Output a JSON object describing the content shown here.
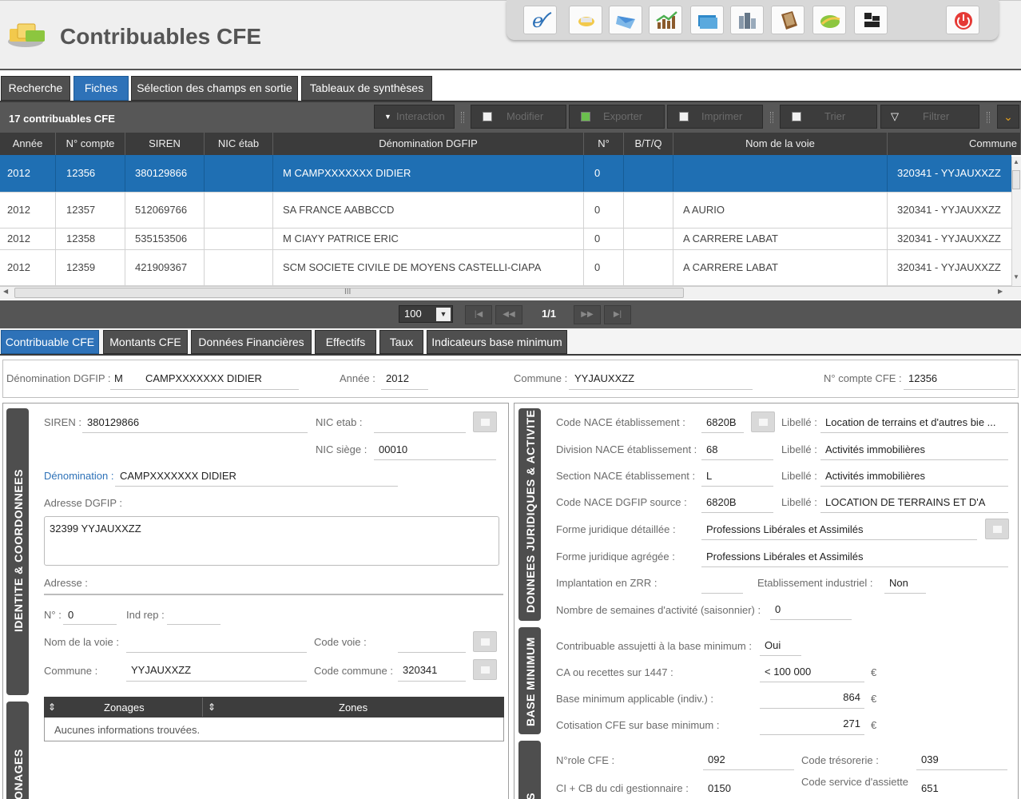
{
  "app": {
    "title": "Contribuables CFE"
  },
  "toolbar": {
    "icons": [
      "e-icon",
      "hand-icon",
      "envelope-icon",
      "growth-chart-icon",
      "card-icon",
      "buildings-icon",
      "document-icon",
      "leaf-icon",
      "blocks-icon",
      "power-icon"
    ]
  },
  "main_tabs": [
    "Recherche",
    "Fiches",
    "Sélection des champs en sortie",
    "Tableaux de synthèses"
  ],
  "grid": {
    "count_label": "17 contribuables CFE",
    "actions": {
      "interaction": "Interaction",
      "modifier": "Modifier",
      "exporter": "Exporter",
      "imprimer": "Imprimer",
      "trier": "Trier",
      "filtrer": "Filtrer"
    },
    "columns": [
      "Année",
      "N° compte",
      "SIREN",
      "NIC étab",
      "Dénomination DGFIP",
      "N°",
      "B/T/Q",
      "Nom de la voie",
      "Commune"
    ],
    "rows": [
      [
        "2012",
        "12356",
        "380129866",
        "",
        "M CAMPXXXXXXX DIDIER",
        "0",
        "",
        "",
        "320341 - YYJAUXXZZ"
      ],
      [
        "2012",
        "12357",
        "512069766",
        "",
        "SA FRANCE AABBCCD",
        "0",
        "",
        "A AURIO",
        "320341 - YYJAUXXZZ"
      ],
      [
        "2012",
        "12358",
        "535153506",
        "",
        "M CIAYY PATRICE ERIC",
        "0",
        "",
        "A CARRERE LABAT",
        "320341 - YYJAUXXZZ"
      ],
      [
        "2012",
        "12359",
        "421909367",
        "",
        "SCM SOCIETE CIVILE DE MOYENS CASTELLI-CIAPA",
        "0",
        "",
        "A CARRERE LABAT",
        "320341 - YYJAUXXZZ"
      ]
    ],
    "hscroll_grip": "III"
  },
  "pager": {
    "page_size": "100",
    "page_info": "1/1",
    "first": "|◀",
    "prev": "◀◀",
    "next": "▶▶",
    "last": "▶|"
  },
  "detail_tabs": [
    "Contribuable CFE",
    "Montants CFE",
    "Données Financières",
    "Effectifs",
    "Taux",
    "Indicateurs base minimum"
  ],
  "summary": {
    "denom_label": "Dénomination DGFIP :",
    "denom_civ": "M",
    "denom_name": "CAMPXXXXXXX DIDIER",
    "annee_label": "Année :",
    "annee": "2012",
    "commune_label": "Commune :",
    "commune": "YYJAUXXZZ",
    "compte_label": "N° compte CFE :",
    "compte": "12356"
  },
  "identite": {
    "section_title": "IDENTITE & COORDONNEES",
    "siren_label": "SIREN :",
    "siren": "380129866",
    "nic_etab_label": "NIC etab :",
    "nic_etab": "",
    "nic_siege_label": "NIC siège :",
    "nic_siege": "00010",
    "denomination_label": "Dénomination :",
    "denomination": "CAMPXXXXXXX DIDIER",
    "adresse_dgfip_label": "Adresse DGFIP :",
    "adresse_dgfip": "32399 YYJAUXXZZ",
    "adresse_label": "Adresse :",
    "num_label": "N° :",
    "num": "0",
    "ind_rep_label": "Ind rep :",
    "ind_rep": "",
    "voie_label": "Nom de la voie :",
    "voie": "",
    "code_voie_label": "Code voie :",
    "code_voie": "",
    "commune_label": "Commune :",
    "commune": "YYJAUXXZZ",
    "code_commune_label": "Code commune :",
    "code_commune": "320341"
  },
  "zonages": {
    "section_title": "ZONAGES",
    "col_zonages": "Zonages",
    "col_zones": "Zones",
    "empty": "Aucunes informations trouvées."
  },
  "donnees": {
    "section_title": "DONNEES JURIDIQUES & ACTIVITE",
    "libelle_label": "Libellé :",
    "rows": [
      {
        "label": "Code NACE établissement :",
        "value": "6820B",
        "libelle": "Location de terrains et d'autres bie ..."
      },
      {
        "label": "Division NACE établissement :",
        "value": "68",
        "libelle": "Activités immobilières"
      },
      {
        "label": "Section NACE établissement :",
        "value": "L",
        "libelle": "Activités immobilières"
      },
      {
        "label": "Code NACE DGFIP source :",
        "value": "6820B",
        "libelle": "LOCATION DE TERRAINS ET D'A"
      }
    ],
    "forme_det_label": "Forme juridique détaillée :",
    "forme_det": "Professions Libérales et Assimilés",
    "forme_agr_label": "Forme juridique agrégée :",
    "forme_agr": "Professions Libérales et Assimilés",
    "zrr_label": "Implantation en ZRR :",
    "zrr": "",
    "indus_label": "Etablissement industriel :",
    "indus": "Non",
    "semaines_label": "Nombre de semaines d'activité (saisonnier) :",
    "semaines": "0"
  },
  "base_min": {
    "section_title": "BASE MINIMUM",
    "assujetti_label": "Contribuable assujetti à la base minimum :",
    "assujetti": "Oui",
    "ca_label": "CA ou recettes sur 1447 :",
    "ca": "< 100 000",
    "base_label": "Base minimum applicable (indiv.) :",
    "base": "864",
    "cotis_label": "Cotisation CFE sur base minimum :",
    "cotis": "271",
    "currency": "€"
  },
  "divers": {
    "section_title": "DIVERS",
    "role_label": "N°role CFE :",
    "role": "092",
    "tresorerie_label": "Code trésorerie :",
    "tresorerie": "039",
    "cdi_label": "CI + CB du cdi gestionnaire :",
    "cdi": "0150",
    "service_label": "Code service d'assiette",
    "service": "651"
  }
}
